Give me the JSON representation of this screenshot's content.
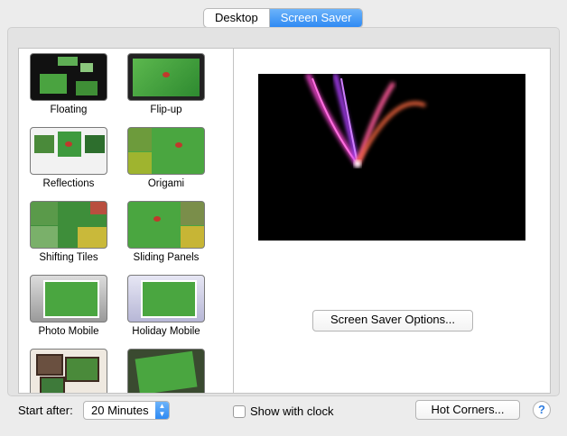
{
  "tabs": [
    {
      "label": "Desktop",
      "active": false
    },
    {
      "label": "Screen Saver",
      "active": true
    }
  ],
  "savers": [
    {
      "label": "Floating",
      "icon": "floating-thumbnail"
    },
    {
      "label": "Flip-up",
      "icon": "flip-up-thumbnail"
    },
    {
      "label": "Reflections",
      "icon": "reflections-thumbnail"
    },
    {
      "label": "Origami",
      "icon": "origami-thumbnail"
    },
    {
      "label": "Shifting Tiles",
      "icon": "shifting-tiles-thumbnail"
    },
    {
      "label": "Sliding Panels",
      "icon": "sliding-panels-thumbnail"
    },
    {
      "label": "Photo Mobile",
      "icon": "photo-mobile-thumbnail"
    },
    {
      "label": "Holiday Mobile",
      "icon": "holiday-mobile-thumbnail"
    },
    {
      "label": "",
      "icon": "photo-wall-thumbnail"
    },
    {
      "label": "",
      "icon": "vintage-prints-thumbnail"
    }
  ],
  "preview": {
    "icon": "flurry-preview"
  },
  "options_button": "Screen Saver Options...",
  "start_after": {
    "label": "Start after:",
    "value": "20 Minutes"
  },
  "show_clock": {
    "label": "Show with clock",
    "checked": false
  },
  "hot_corners_button": "Hot Corners...",
  "help_button": "?"
}
